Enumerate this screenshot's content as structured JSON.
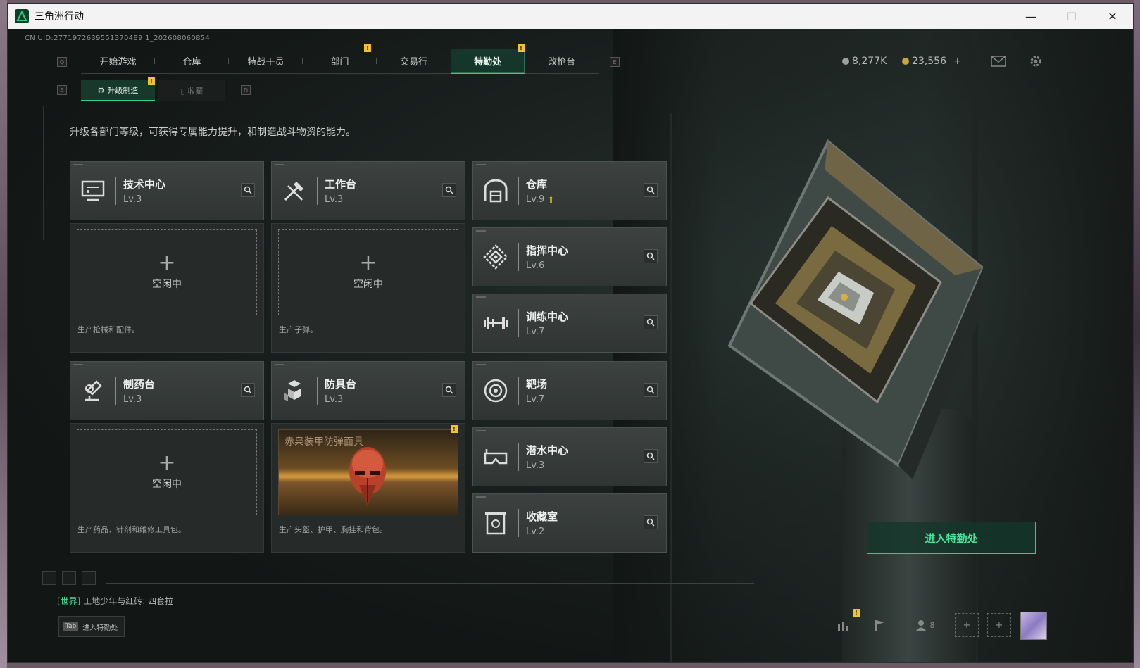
{
  "window": {
    "title": "三角洲行动",
    "minimize": "—",
    "maximize": "☐",
    "close": "✕"
  },
  "uid": "CN UID:2771972639551370489 1_202608060854",
  "hotkeys": {
    "q": "Q",
    "e": "E",
    "a": "A",
    "d": "D"
  },
  "nav": {
    "tabs": [
      {
        "label": "开始游戏",
        "active": false
      },
      {
        "label": "仓库",
        "active": false
      },
      {
        "label": "特战干员",
        "active": false
      },
      {
        "label": "部门",
        "active": false,
        "badge": "!"
      },
      {
        "label": "交易行",
        "active": false
      },
      {
        "label": "特勤处",
        "active": true,
        "badge": "!"
      },
      {
        "label": "改枪台",
        "active": false
      }
    ]
  },
  "currency": {
    "silver": "8,277K",
    "gold": "23,556",
    "add": "+"
  },
  "subtabs": {
    "upgrade": "升级制造",
    "collection": "收藏",
    "badge": "!"
  },
  "description": "升级各部门等级，可获得专属能力提升，和制造战斗物资的能力。",
  "departments": [
    {
      "name": "技术中心",
      "level": "Lv.3",
      "icon": "tech-center-icon"
    },
    {
      "name": "工作台",
      "level": "Lv.3",
      "icon": "workbench-icon"
    },
    {
      "name": "仓库",
      "level": "Lv.9",
      "icon": "warehouse-icon",
      "upgradable": true
    },
    {
      "name": "指挥中心",
      "level": "Lv.6",
      "icon": "command-center-icon"
    },
    {
      "name": "训练中心",
      "level": "Lv.7",
      "icon": "training-center-icon"
    },
    {
      "name": "制药台",
      "level": "Lv.3",
      "icon": "pharmacy-icon"
    },
    {
      "name": "防具台",
      "level": "Lv.3",
      "icon": "armor-bench-icon"
    },
    {
      "name": "靶场",
      "level": "Lv.7",
      "icon": "shooting-range-icon"
    },
    {
      "name": "潜水中心",
      "level": "Lv.3",
      "icon": "diving-center-icon"
    },
    {
      "name": "收藏室",
      "level": "Lv.2",
      "icon": "collection-room-icon"
    }
  ],
  "production": {
    "idle_label": "空闲中",
    "plus": "+",
    "tech_desc": "生产枪械和配件。",
    "workbench_desc": "生产子弹。",
    "pharmacy_desc": "生产药品、针剂和维修工具包。",
    "armor_desc": "生产头盔、护甲、胸挂和背包。",
    "armor_item": "赤枭装甲防弹面具",
    "armor_badge": "!"
  },
  "enter_button": "进入特勤处",
  "chat": {
    "channel": "[世界]",
    "sender": "工地少年与红砖:",
    "message": "四套拉"
  },
  "tab_hint": {
    "key": "Tab",
    "label": "进入特勤处"
  },
  "bottom": {
    "friends_count": "8",
    "badge": "!"
  },
  "colors": {
    "accent": "#33d283",
    "badge": "#f2c230",
    "card": "#3a3f3e"
  }
}
